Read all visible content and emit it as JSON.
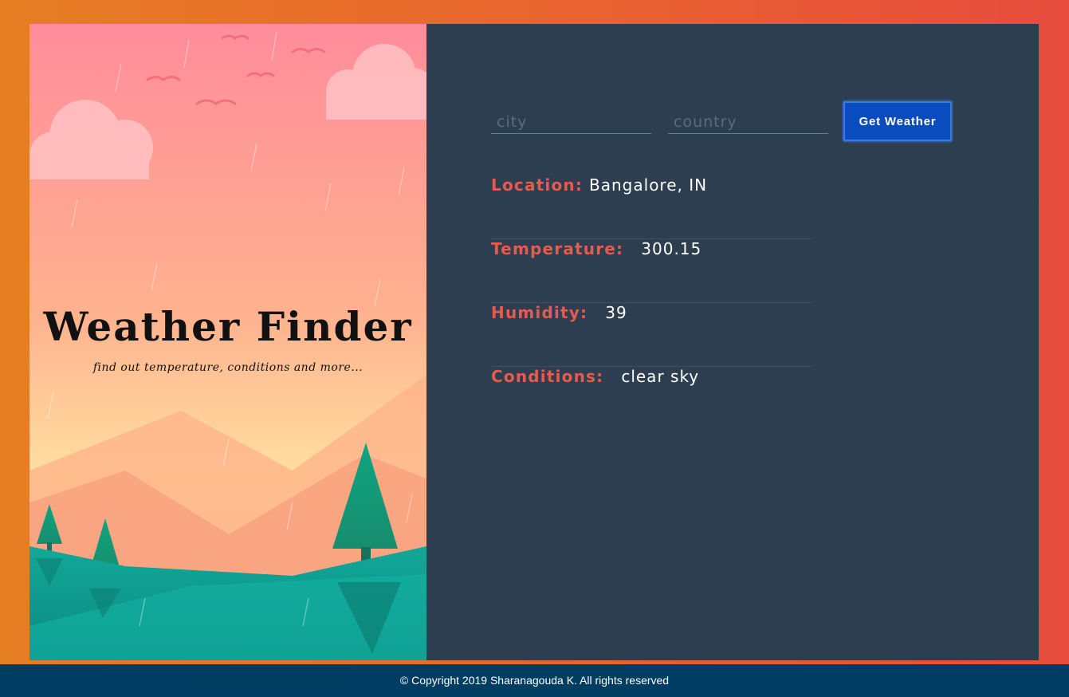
{
  "app": {
    "title": "Weather Finder",
    "subtitle": "find out temperature, conditions and more..."
  },
  "form": {
    "city_placeholder": "city",
    "country_placeholder": "country",
    "city_value": "",
    "country_value": "",
    "submit_label": "Get Weather"
  },
  "results": {
    "location_label": "Location:",
    "location_value": "Bangalore, IN",
    "temperature_label": "Temperature:",
    "temperature_value": "300.15",
    "humidity_label": "Humidity:",
    "humidity_value": "39",
    "conditions_label": "Conditions:",
    "conditions_value": "clear sky"
  },
  "footer": {
    "copyright": "© Copyright 2019 Sharanagouda K. All rights reserved"
  },
  "colors": {
    "accent": "#e74c3c",
    "panel": "#2c3e50",
    "button": "#0a4bbf",
    "footer": "#003d63",
    "background_gradient_start": "#e67e22"
  },
  "icons": {
    "illustration": "rainy-mountain-landscape-illustration"
  }
}
